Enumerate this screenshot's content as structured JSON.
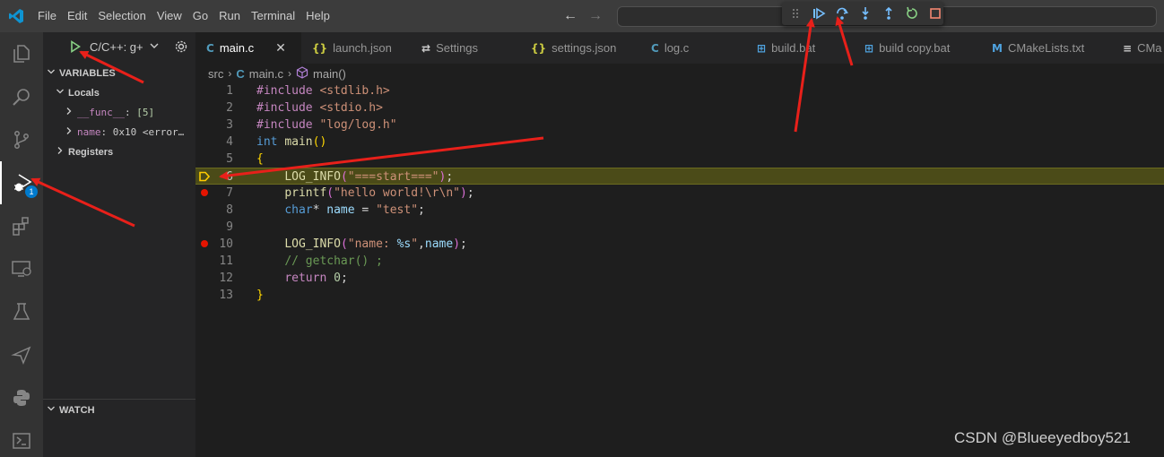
{
  "menu": {
    "items": [
      "File",
      "Edit",
      "Selection",
      "View",
      "Go",
      "Run",
      "Terminal",
      "Help"
    ]
  },
  "icons": {
    "app": "vscode-logo-icon",
    "debug_toolbar": [
      "drag-grip-icon",
      "continue-icon",
      "step-over-icon",
      "step-into-icon",
      "step-out-icon",
      "restart-icon",
      "stop-icon"
    ],
    "activity": [
      "explorer-icon",
      "search-icon",
      "source-control-icon",
      "run-debug-icon",
      "extensions-icon",
      "remote-explorer-icon",
      "testing-icon",
      "deploy-icon",
      "python-icon",
      "remote-icon"
    ]
  },
  "activity": {
    "debug_badge": "1"
  },
  "sidebar": {
    "run_config": "C/C++: g+",
    "variables_title": "VARIABLES",
    "locals_label": "Locals",
    "locals": [
      {
        "name": "__func__",
        "sep": ": ",
        "value": "[5]"
      },
      {
        "name": "name",
        "sep": ": ",
        "value": "0x10 <error…"
      }
    ],
    "registers_label": "Registers",
    "watch_title": "WATCH"
  },
  "tabs": [
    {
      "icon": "C",
      "label": "main.c",
      "active": true,
      "close": "✕"
    },
    {
      "icon": "{}",
      "label": "launch.json"
    },
    {
      "icon": "⇄",
      "label": "Settings"
    },
    {
      "icon": "{}",
      "label": "settings.json"
    },
    {
      "icon": "C",
      "label": "log.c"
    },
    {
      "icon": "⊞",
      "label": "build.bat"
    },
    {
      "icon": "⊞",
      "label": "build copy.bat"
    },
    {
      "icon": "M",
      "label": "CMakeLists.txt"
    },
    {
      "icon": "≡",
      "label": "CMa"
    }
  ],
  "breadcrumb": {
    "folder": "src",
    "file_icon": "C",
    "file": "main.c",
    "symbol": "main()"
  },
  "editor": {
    "current_line": 6,
    "breakpoints": [
      7,
      10
    ],
    "lines": [
      {
        "n": "1",
        "t": [
          [
            "k-pp",
            "#include "
          ],
          [
            "k-inc",
            "<stdlib.h>"
          ]
        ]
      },
      {
        "n": "2",
        "t": [
          [
            "k-pp",
            "#include "
          ],
          [
            "k-inc",
            "<stdio.h>"
          ]
        ]
      },
      {
        "n": "3",
        "t": [
          [
            "k-pp",
            "#include "
          ],
          [
            "k-inc",
            "\"log/log.h\""
          ]
        ]
      },
      {
        "n": "4",
        "t": [
          [
            "k-type",
            "int "
          ],
          [
            "k-fn",
            "main"
          ],
          [
            "k-br",
            "()"
          ]
        ]
      },
      {
        "n": "5",
        "t": [
          [
            "k-br",
            "{"
          ]
        ]
      },
      {
        "n": "6",
        "t": [
          [
            "",
            "    "
          ],
          [
            "k-fn",
            "LOG_INFO"
          ],
          [
            "k-br2",
            "("
          ],
          [
            "k-str",
            "\"===start===\""
          ],
          [
            "k-br2",
            ")"
          ],
          [
            "",
            ";"
          ]
        ]
      },
      {
        "n": "7",
        "t": [
          [
            "",
            "    "
          ],
          [
            "k-fn",
            "printf"
          ],
          [
            "k-br2",
            "("
          ],
          [
            "k-str",
            "\"hello world!\\r\\n\""
          ],
          [
            "k-br2",
            ")"
          ],
          [
            "",
            ";"
          ]
        ]
      },
      {
        "n": "8",
        "t": [
          [
            "",
            "    "
          ],
          [
            "k-type",
            "char"
          ],
          [
            "",
            "* "
          ],
          [
            "k-var",
            "name"
          ],
          [
            "",
            " = "
          ],
          [
            "k-str",
            "\"test\""
          ],
          [
            "",
            ";"
          ]
        ]
      },
      {
        "n": "9",
        "t": []
      },
      {
        "n": "10",
        "t": [
          [
            "",
            "    "
          ],
          [
            "k-fn",
            "LOG_INFO"
          ],
          [
            "k-br2",
            "("
          ],
          [
            "k-str",
            "\"name: "
          ],
          [
            "k-var",
            "%s"
          ],
          [
            "k-str",
            "\""
          ],
          [
            "",
            ","
          ],
          [
            "k-var",
            "name"
          ],
          [
            "k-br2",
            ")"
          ],
          [
            "",
            ";"
          ]
        ]
      },
      {
        "n": "11",
        "t": [
          [
            "",
            "    "
          ],
          [
            "k-cm",
            "// getchar() ;"
          ]
        ]
      },
      {
        "n": "12",
        "t": [
          [
            "",
            "    "
          ],
          [
            "k-pp",
            "return "
          ],
          [
            "k-num",
            "0"
          ],
          [
            "",
            ";"
          ]
        ]
      },
      {
        "n": "13",
        "t": [
          [
            "k-br",
            "}"
          ]
        ]
      }
    ]
  },
  "watermark": "CSDN @Blueeyedboy521"
}
